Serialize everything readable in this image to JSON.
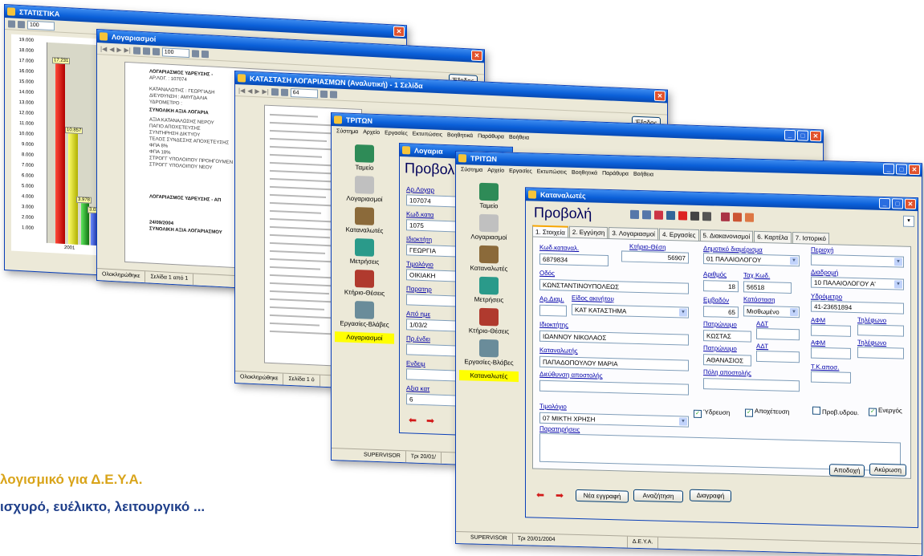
{
  "windows": {
    "stats": {
      "title": "ΣΤΑΤΙΣΤΙΚΑ",
      "zoom": "100"
    },
    "bills": {
      "title": "Λογαριασμοί",
      "zoom": "100",
      "exit_label": "Έξοδος",
      "lines": [
        "ΛΟΓΑΡΙΑΣΜΟΣ ΥΔΡΕΥΣΗΣ -",
        "ΑΡ.ΛΟΓ. : 107074",
        "ΚΑΤΑΝΑΛΩΤΗΣ : ΓΕΩΡΓΙΑΔΗ",
        "ΔΙΕΥΘΥΝΣΗ : ΑΜΥΓΔΑΛΙΑ",
        "ΥΔΡΟΜΕΤΡΟ :",
        "ΣΥΝΟΛΙΚΗ ΑΞΙΑ ΛΟΓΑΡΙΑ",
        "ΑΞΙΑ ΚΑΤΑΝΑΛΩΣΗΣ ΝΕΡΟΥ",
        "ΠΑΓΙΟ ΑΠΟΧΕΤΕΥΣΗΣ",
        "ΣΥΝΤΗΡΗΣΗ ΔΙΚΤΥΟΥ",
        "ΤΕΛΟΣ ΣΥΝΔΕΣΗΣ ΑΠΟΧΕΤΕΥΣΗΣ",
        "ΦΠΑ 8%",
        "ΦΠΑ 18%",
        "ΣΤΡΟΓΓ ΥΠΟΛΟΙΠΟΥ ΠΡΟΗΓΟΥΜΕΝ",
        "ΣΤΡΟΓΓ ΥΠΟΛΟΙΠΟΥ ΝΕΟΥ",
        "ΛΟΓΑΡΙΑΣΜΟΣ ΥΔΡΕΥΣΗΣ - ΑΠ",
        "24/09/2004",
        "ΣΥΝΟΛΙΚΗ ΑΞΙΑ ΛΟΓΑΡΙΑΣΜΟΥ"
      ],
      "status": [
        "Ολοκληρώθηκε",
        "Σελίδα 1 από 1"
      ]
    },
    "report": {
      "title": "ΚΑΤΑΣΤΑΣΗ ΛΟΓΑΡΙΑΣΜΩΝ (Αναλυτική) - 1 Σελίδα",
      "zoom": "64",
      "exit_label": "Έξοδος",
      "status": [
        "Ολοκληρώθηκε",
        "Σελίδα 1 ό"
      ]
    },
    "triton_back": {
      "title": "ΤΡΙΤΩΝ",
      "inner_title": "Λογαρια",
      "inner_heading": "Προβολ",
      "fields": [
        {
          "label": "Αρ.Λογαρ",
          "value": "107074"
        },
        {
          "label": "Κωδ.κατα",
          "value": "1075"
        },
        {
          "label": "Ιδιοκτήτη",
          "value": "ΓΕΩΡΓΙΑ"
        },
        {
          "label": "Τιμολόγιο",
          "value": "ΟΙΚΙΑΚΗ"
        },
        {
          "label": "Παρατηρ",
          "value": ""
        },
        {
          "label": "Από ημε",
          "value": "1/03/2"
        },
        {
          "label": "Πρ.ένδει",
          "value": ""
        },
        {
          "label": "Ενδειμ",
          "value": ""
        },
        {
          "label": "Αξια κατ",
          "value": "6"
        }
      ],
      "status": [
        "SUPERVISOR",
        "Τρι 20/01/"
      ]
    },
    "triton_front": {
      "title": "ΤΡΙΤΩΝ",
      "status": [
        "SUPERVISOR",
        "Τρι 20/01/2004",
        "Δ.Ε.Υ.Α."
      ]
    }
  },
  "menu": [
    "Σύστημα",
    "Αρχείο",
    "Εργασίες",
    "Εκτυπώσεις",
    "Βοηθητικά",
    "Παράθυρα",
    "Βοήθεια"
  ],
  "sidebar": {
    "items": [
      "Ταμείο",
      "Λογαριασμοί",
      "Καταναλωτές",
      "Μετρήσεις",
      "Κτήριο-Θέσεις",
      "Εργασίες-Βλάβες"
    ],
    "back_active": "Λογαριασμοί",
    "front_active": "Καταναλωτές"
  },
  "form": {
    "window_title": "Καταναλωτές",
    "heading": "Προβολή",
    "tabs": [
      "1. Στοιχεία",
      "2. Εγγύηση",
      "3. Λογαριασμοί",
      "4. Εργασίες",
      "5. Διακανονισμοί",
      "6. Καρτέλα",
      "7. Ιστορικό"
    ],
    "fields": {
      "kod_katanal": {
        "label": "Κωδ.καταναλ.",
        "value": "6879834"
      },
      "ktirio_thesi": {
        "label": "Κτήριο-Θέση",
        "value": "56907"
      },
      "dimotiko": {
        "label": "Δημοτικό διαμέρισμα",
        "value": "01  ΠΑΛΑΙΟΛΟΓΟΥ"
      },
      "periochi": {
        "label": "Περιοχή",
        "value": ""
      },
      "odos": {
        "label": "Οδός",
        "value": "ΚΩΝΣΤΑΝΤΙΝΟΥΠΟΛΕΩΣ"
      },
      "arithmos": {
        "label": "Αριθμός",
        "value": "18"
      },
      "tach_kod": {
        "label": "Ταχ.Κωδ.",
        "value": "56518"
      },
      "diadromi": {
        "label": "Διαδρομή",
        "value": "10  ΠΑΛΑΙΟΛΟΓΟΥ Α'"
      },
      "ar_diam": {
        "label": "Αρ.Διαμ.",
        "value": ""
      },
      "eidos_akinitou": {
        "label": "Είδος ακινήτου",
        "value": "ΚΑΤ  ΚΑΤΑΣΤΗΜΑ"
      },
      "emvadon": {
        "label": "Εμβαδόν",
        "value": "65"
      },
      "katastasi": {
        "label": "Κατάσταση",
        "value": "Μισθωμένο"
      },
      "ydrometro": {
        "label": "Υδρόμετρο",
        "value": "41-23651894"
      },
      "idioktitis": {
        "label": "Ιδιοκτήτης",
        "value": "ΙΩΑΝΝΟΥ ΝΙΚΟΛΑΟΣ"
      },
      "patronymo1": {
        "label": "Πατρώνυμο",
        "value": "ΚΩΣΤΑΣ"
      },
      "adt1": {
        "label": "ΑΔΤ",
        "value": ""
      },
      "afm1": {
        "label": "ΑΦΜ",
        "value": ""
      },
      "tilefono1": {
        "label": "Τηλέφωνο",
        "value": ""
      },
      "katanalotis": {
        "label": "Καταναλωτής",
        "value": "ΠΑΠΑΔΟΠΟΥΛΟΥ ΜΑΡΙΑ"
      },
      "patronymo2": {
        "label": "Πατρώνυμο",
        "value": "ΑΘΑΝΑΣΙΟΣ"
      },
      "adt2": {
        "label": "ΑΔΤ",
        "value": ""
      },
      "afm2": {
        "label": "ΑΦΜ",
        "value": ""
      },
      "tilefono2": {
        "label": "Τηλέφωνο",
        "value": ""
      },
      "diefthynsi": {
        "label": "Διεύθυνση αποστολής",
        "value": ""
      },
      "poli": {
        "label": "Πόλη αποστολής",
        "value": ""
      },
      "tk": {
        "label": "Τ.Κ.αποσ.",
        "value": ""
      },
      "timologio": {
        "label": "Τιμολόγιο",
        "value": "07  ΜΙΚΤΗ ΧΡΗΣΗ"
      },
      "paratiriseis": {
        "label": "Παρατηρήσεις",
        "value": ""
      }
    },
    "checks": [
      {
        "label": "Ύδρευση",
        "checked": true
      },
      {
        "label": "Αποχέτευση",
        "checked": true
      },
      {
        "label": "Προβ.υδρου.",
        "checked": false
      },
      {
        "label": "Ενεργός",
        "checked": true
      }
    ],
    "buttons": {
      "accept": "Αποδοχή",
      "cancel": "Ακύρωση",
      "new": "Νέα εγγραφή",
      "search": "Αναζήτηση",
      "delete": "Διαγραφή"
    }
  },
  "chart": {
    "y_ticks": [
      "19.000",
      "18.000",
      "17.000",
      "16.000",
      "15.000",
      "14.000",
      "13.000",
      "12.000",
      "11.000",
      "10.000",
      "9.000",
      "8.000",
      "7.000",
      "6.000",
      "5.000",
      "4.000",
      "3.000",
      "2.000",
      "1.000"
    ],
    "labels": [
      "17.231",
      "10.857",
      "3.978",
      "3.039"
    ],
    "x_label": "2001"
  },
  "tagline": {
    "line1": "λογισμικό για Δ.Ε.Υ.Α.",
    "line2": "ισχυρό, ευέλικτο, λειτουργικό ..."
  }
}
